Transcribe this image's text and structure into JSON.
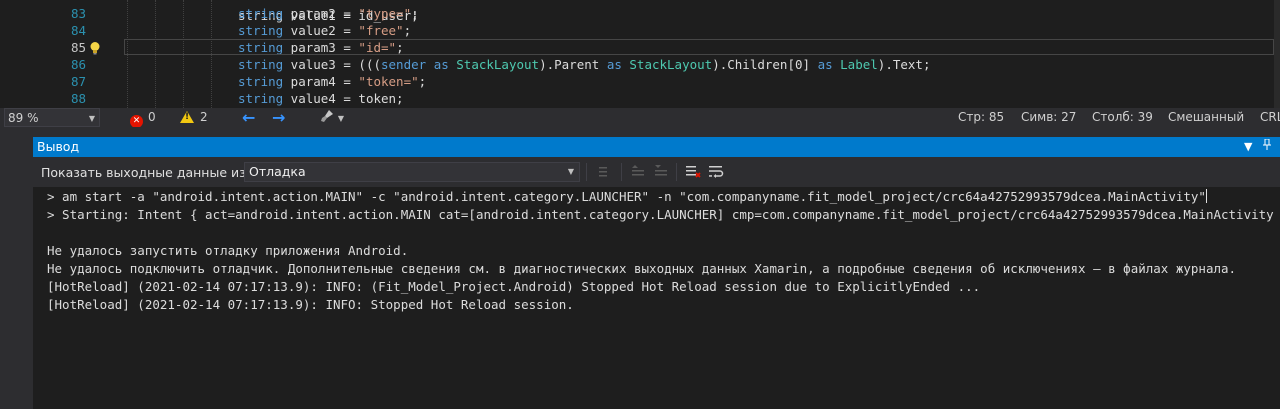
{
  "editor": {
    "lines": [
      {
        "number": "83",
        "tokens": [
          {
            "t": "string",
            "c": "kw"
          },
          {
            "t": " param2 = ",
            "c": ""
          },
          {
            "t": "\"type=\"",
            "c": "str"
          },
          {
            "t": ";",
            "c": ""
          }
        ]
      },
      {
        "number": "84",
        "tokens": [
          {
            "t": "string",
            "c": "kw"
          },
          {
            "t": " value2 = ",
            "c": ""
          },
          {
            "t": "\"free\"",
            "c": "str"
          },
          {
            "t": ";",
            "c": ""
          }
        ]
      },
      {
        "number": "85",
        "tokens": [
          {
            "t": "string",
            "c": "kw"
          },
          {
            "t": " param3 = ",
            "c": ""
          },
          {
            "t": "\"id=\"",
            "c": "str"
          },
          {
            "t": ";",
            "c": ""
          }
        ]
      },
      {
        "number": "86",
        "tokens": [
          {
            "t": "string",
            "c": "kw"
          },
          {
            "t": " value3 = (((",
            "c": ""
          },
          {
            "t": "sender",
            "c": "kw"
          },
          {
            "t": " ",
            "c": ""
          },
          {
            "t": "as",
            "c": "kw"
          },
          {
            "t": " ",
            "c": ""
          },
          {
            "t": "StackLayout",
            "c": "typ"
          },
          {
            "t": ").Parent ",
            "c": ""
          },
          {
            "t": "as",
            "c": "kw"
          },
          {
            "t": " ",
            "c": ""
          },
          {
            "t": "StackLayout",
            "c": "typ"
          },
          {
            "t": ").Children[0] ",
            "c": ""
          },
          {
            "t": "as",
            "c": "kw"
          },
          {
            "t": " ",
            "c": ""
          },
          {
            "t": "Label",
            "c": "typ"
          },
          {
            "t": ").Text;",
            "c": ""
          }
        ]
      },
      {
        "number": "87",
        "tokens": [
          {
            "t": "string",
            "c": "kw"
          },
          {
            "t": " param4 = ",
            "c": ""
          },
          {
            "t": "\"token=\"",
            "c": "str"
          },
          {
            "t": ";",
            "c": ""
          }
        ]
      },
      {
        "number": "88",
        "tokens": [
          {
            "t": "string",
            "c": "kw"
          },
          {
            "t": " value4 = token;",
            "c": ""
          }
        ]
      }
    ],
    "partial_top_line": "string value1 = id_user;"
  },
  "status": {
    "zoom": "89 %",
    "errors": "0",
    "warnings": "2",
    "line": "Стр: 85",
    "chars": "Симв: 27",
    "column": "Столб: 39",
    "line_endings": "Смешанный",
    "encoding": "CRL"
  },
  "output": {
    "title": "Вывод",
    "show_from_label": "Показать выходные данные из:",
    "source": "Отладка",
    "lines": [
      "> am start -a \"android.intent.action.MAIN\" -c \"android.intent.category.LAUNCHER\" -n \"com.companyname.fit_model_project/crc64a42752993579dcea.MainActivity\"",
      "> Starting: Intent { act=android.intent.action.MAIN cat=[android.intent.category.LAUNCHER] cmp=com.companyname.fit_model_project/crc64a42752993579dcea.MainActivity }",
      "",
      "Не удалось запустить отладку приложения Android.",
      "Не удалось подключить отладчик. Дополнительные сведения см. в диагностических выходных данных Xamarin, а подробные сведения об исключениях — в файлах журнала.",
      "[HotReload] (2021-02-14 07:17:13.9): INFO: (Fit_Model_Project.Android) Stopped Hot Reload session due to ExplicitlyEnded ...",
      "[HotReload] (2021-02-14 07:17:13.9): INFO: Stopped Hot Reload session."
    ]
  },
  "colors": {
    "accent": "#007acc",
    "error": "#e51400",
    "warning": "#f2c811"
  }
}
